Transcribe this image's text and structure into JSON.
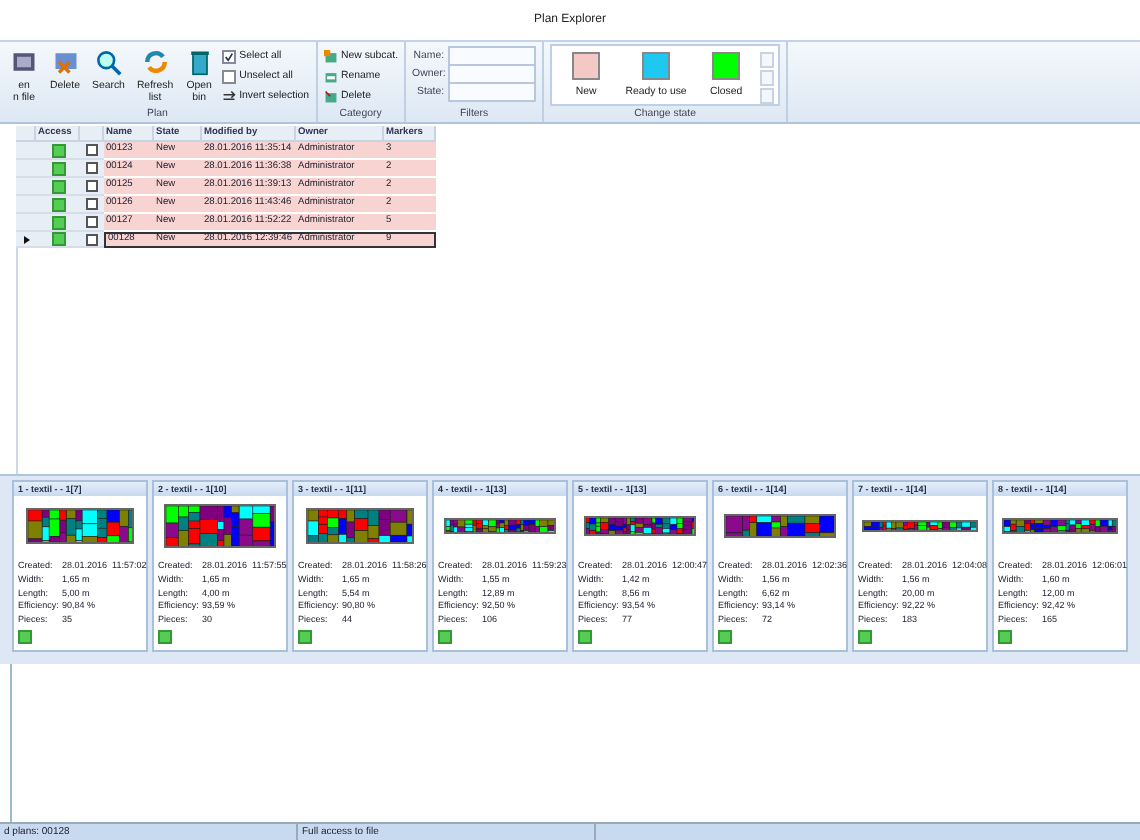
{
  "window": {
    "title": "Plan Explorer"
  },
  "ribbon": {
    "groups": [
      {
        "label": "Plan",
        "buttons": [
          {
            "kind": "file",
            "lines": [
              "en",
              "n file"
            ]
          },
          {
            "kind": "delete",
            "lines": [
              "Delete"
            ]
          },
          {
            "kind": "search",
            "lines": [
              "Search"
            ]
          },
          {
            "kind": "refresh",
            "lines": [
              "Refresh",
              "list"
            ]
          },
          {
            "kind": "bin",
            "lines": [
              "Open",
              "bin"
            ]
          }
        ],
        "small": [
          {
            "kind": "check",
            "label": "Select all",
            "checked": true
          },
          {
            "kind": "check",
            "label": "Unselect all",
            "checked": false
          },
          {
            "kind": "invert",
            "label": "Invert selection"
          }
        ]
      },
      {
        "label": "Category",
        "small": [
          {
            "kind": "new",
            "label": "New subcat."
          },
          {
            "kind": "rename",
            "label": "Rename"
          },
          {
            "kind": "delete",
            "label": "Delete"
          }
        ]
      },
      {
        "label": "Filters",
        "fields": [
          {
            "label": "Name:"
          },
          {
            "label": "Owner:"
          },
          {
            "label": "State:"
          }
        ]
      },
      {
        "label": "Change state",
        "states": [
          {
            "label": "New",
            "color": "#f4c8c4"
          },
          {
            "label": "Ready to use",
            "color": "#1ec8f0"
          },
          {
            "label": "Closed",
            "color": "#00ff00"
          }
        ]
      }
    ]
  },
  "table": {
    "columns": [
      "Access",
      "Name",
      "State",
      "Modified by",
      "Owner",
      "Markers"
    ],
    "rows": [
      {
        "name": "00123",
        "state": "New",
        "modified": "28.01.2016 11:35:14",
        "owner": "Administrator",
        "markers": "3",
        "checked": false,
        "selected": false
      },
      {
        "name": "00124",
        "state": "New",
        "modified": "28.01.2016 11:36:38",
        "owner": "Administrator",
        "markers": "2",
        "checked": false,
        "selected": false
      },
      {
        "name": "00125",
        "state": "New",
        "modified": "28.01.2016 11:39:13",
        "owner": "Administrator",
        "markers": "2",
        "checked": false,
        "selected": false
      },
      {
        "name": "00126",
        "state": "New",
        "modified": "28.01.2016 11:43:46",
        "owner": "Administrator",
        "markers": "2",
        "checked": false,
        "selected": false
      },
      {
        "name": "00127",
        "state": "New",
        "modified": "28.01.2016 11:52:22",
        "owner": "Administrator",
        "markers": "5",
        "checked": false,
        "selected": false
      },
      {
        "name": "00128",
        "state": "New",
        "modified": "28.01.2016 12:39:46",
        "owner": "Administrator",
        "markers": "9",
        "checked": false,
        "selected": true
      }
    ]
  },
  "cards": [
    {
      "title": "1 - textil - - 1[7]",
      "fields": [
        {
          "label": "Created:",
          "value": "28.01.2016  11:57:02"
        },
        {
          "label": "Width:",
          "value": "1,65 m"
        },
        {
          "label": "Length:",
          "value": "5,00 m"
        },
        {
          "label": "Efficiency:",
          "value": "90,84 %"
        },
        {
          "label": "Pieces:",
          "value": "35"
        }
      ]
    },
    {
      "title": "2 - textil - - 1[10]",
      "fields": [
        {
          "label": "Created:",
          "value": "28.01.2016  11:57:55"
        },
        {
          "label": "Width:",
          "value": "1,65 m"
        },
        {
          "label": "Length:",
          "value": "4,00 m"
        },
        {
          "label": "Efficiency:",
          "value": "93,59 %"
        },
        {
          "label": "Pieces:",
          "value": "30"
        }
      ]
    },
    {
      "title": "3 - textil - - 1[11]",
      "fields": [
        {
          "label": "Created:",
          "value": "28.01.2016  11:58:26"
        },
        {
          "label": "Width:",
          "value": "1,65 m"
        },
        {
          "label": "Length:",
          "value": "5,54 m"
        },
        {
          "label": "Efficiency:",
          "value": "90,80 %"
        },
        {
          "label": "Pieces:",
          "value": "44"
        }
      ]
    },
    {
      "title": "4 - textil - - 1[13]",
      "fields": [
        {
          "label": "Created:",
          "value": "28.01.2016  11:59:23"
        },
        {
          "label": "Width:",
          "value": "1,55 m"
        },
        {
          "label": "Length:",
          "value": "12,89 m"
        },
        {
          "label": "Efficiency:",
          "value": "92,50 %"
        },
        {
          "label": "Pieces:",
          "value": "106"
        }
      ]
    },
    {
      "title": "5 - textil - - 1[13]",
      "fields": [
        {
          "label": "Created:",
          "value": "28.01.2016  12:00:47"
        },
        {
          "label": "Width:",
          "value": "1,42 m"
        },
        {
          "label": "Length:",
          "value": "8,56 m"
        },
        {
          "label": "Efficiency:",
          "value": "93,54 %"
        },
        {
          "label": "Pieces:",
          "value": "77"
        }
      ]
    },
    {
      "title": "6 - textil - - 1[14]",
      "fields": [
        {
          "label": "Created:",
          "value": "28.01.2016  12:02:36"
        },
        {
          "label": "Width:",
          "value": "1,56 m"
        },
        {
          "label": "Length:",
          "value": "6,62 m"
        },
        {
          "label": "Efficiency:",
          "value": "93,14 %"
        },
        {
          "label": "Pieces:",
          "value": "72"
        }
      ]
    },
    {
      "title": "7 - textil - - 1[14]",
      "fields": [
        {
          "label": "Created:",
          "value": "28.01.2016  12:04:08"
        },
        {
          "label": "Width:",
          "value": "1,56 m"
        },
        {
          "label": "Length:",
          "value": "20,00 m"
        },
        {
          "label": "Efficiency:",
          "value": "92,22 %"
        },
        {
          "label": "Pieces:",
          "value": "183"
        }
      ]
    },
    {
      "title": "8 - textil - - 1[14]",
      "fields": [
        {
          "label": "Created:",
          "value": "28.01.2016  12:06:01"
        },
        {
          "label": "Width:",
          "value": "1,60 m"
        },
        {
          "label": "Length:",
          "value": "12,00 m"
        },
        {
          "label": "Efficiency:",
          "value": "92,42 %"
        },
        {
          "label": "Pieces:",
          "value": "165"
        }
      ]
    }
  ],
  "status_bar": [
    "d plans: 00128",
    "Full access to file"
  ]
}
